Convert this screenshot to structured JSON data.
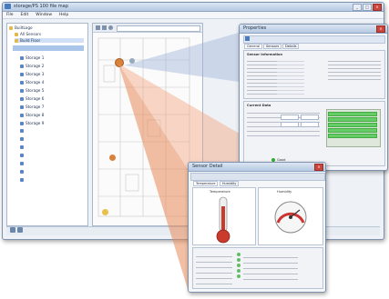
{
  "main_window": {
    "title": "storage/PS 100 file map",
    "menu": [
      "File",
      "Edit",
      "Window",
      "Help"
    ],
    "tree_items": [
      "BuiltLogo",
      "All Sensors",
      "Build Floor",
      "Storage 1",
      "Storage 2",
      "Storage 3",
      "Storage 4",
      "Storage 5",
      "Storage 6",
      "Storage 7",
      "Storage 8",
      "Storage 9"
    ]
  },
  "props_window": {
    "title": "Properties",
    "tabs": [
      "General",
      "Sensors",
      "Details"
    ],
    "section1": "Sensor Information",
    "section2": "Current Data",
    "status_label": "Good"
  },
  "gauge_window": {
    "title": "Sensor Detail",
    "tabs": [
      "Temperature",
      "Humidity"
    ],
    "section_left": "Temperature",
    "section_right": "Humidity"
  },
  "colors": {
    "accent": "#d9823a",
    "title_blue": "#b6c9e2",
    "green": "#6c6"
  }
}
